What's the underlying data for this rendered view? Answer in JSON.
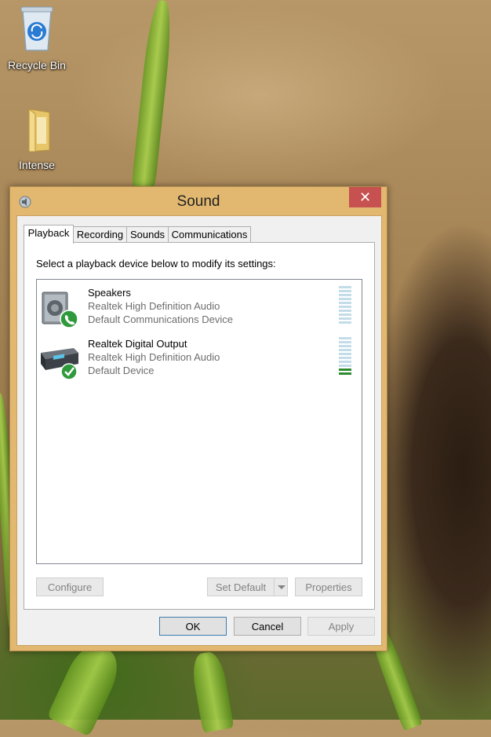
{
  "desktop": {
    "icons": [
      {
        "label": "Recycle Bin",
        "icon": "recycle-bin-icon"
      },
      {
        "label": "Intense",
        "icon": "folder-icon"
      }
    ]
  },
  "window": {
    "title": "Sound",
    "close_glyph": "✕",
    "tabs": [
      {
        "label": "Playback",
        "active": true
      },
      {
        "label": "Recording",
        "active": false
      },
      {
        "label": "Sounds",
        "active": false
      },
      {
        "label": "Communications",
        "active": false
      }
    ],
    "instruction": "Select a playback device below to modify its settings:",
    "devices": [
      {
        "name": "Speakers",
        "driver": "Realtek High Definition Audio",
        "status": "Default Communications Device",
        "icon": "speaker-icon",
        "badge": "phone-badge-icon",
        "level_bars_on": 0
      },
      {
        "name": "Realtek Digital Output",
        "driver": "Realtek High Definition Audio",
        "status": "Default Device",
        "icon": "digital-receiver-icon",
        "badge": "checkmark-badge-icon",
        "level_bars_on": 2
      }
    ],
    "buttons": {
      "configure": "Configure",
      "set_default": "Set Default",
      "properties": "Properties",
      "ok": "OK",
      "cancel": "Cancel",
      "apply": "Apply"
    }
  }
}
